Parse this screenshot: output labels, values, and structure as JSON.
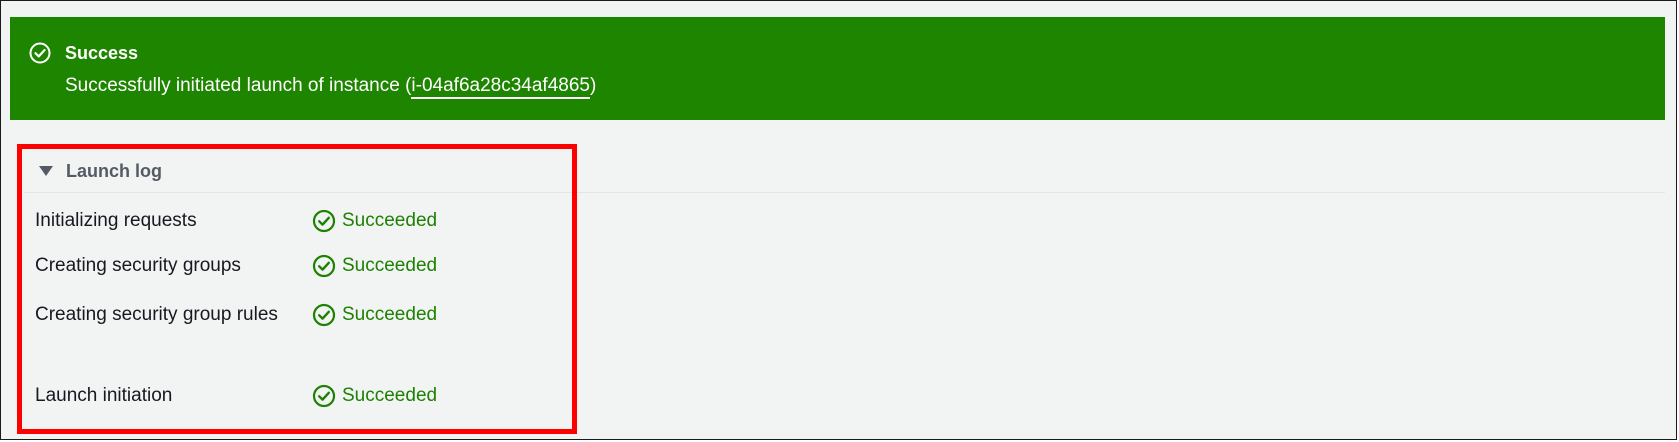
{
  "flash": {
    "title": "Success",
    "message_prefix": "Successfully initiated launch of instance (",
    "instance_id": "i-04af6a28c34af4865",
    "message_suffix": ")",
    "icon": "check-circle-icon",
    "color": "#1e8500"
  },
  "launch_log": {
    "title": "Launch log",
    "expanded": true,
    "rows": [
      {
        "label": "Initializing requests",
        "status": "Succeeded"
      },
      {
        "label": "Creating security groups",
        "status": "Succeeded"
      },
      {
        "label": "Creating security group rules",
        "status": "Succeeded"
      },
      {
        "label": "Launch initiation",
        "status": "Succeeded"
      }
    ],
    "status_color": "#1d8102",
    "status_icon": "check-circle-icon"
  },
  "annotation": {
    "highlight_color": "#ff0000"
  }
}
